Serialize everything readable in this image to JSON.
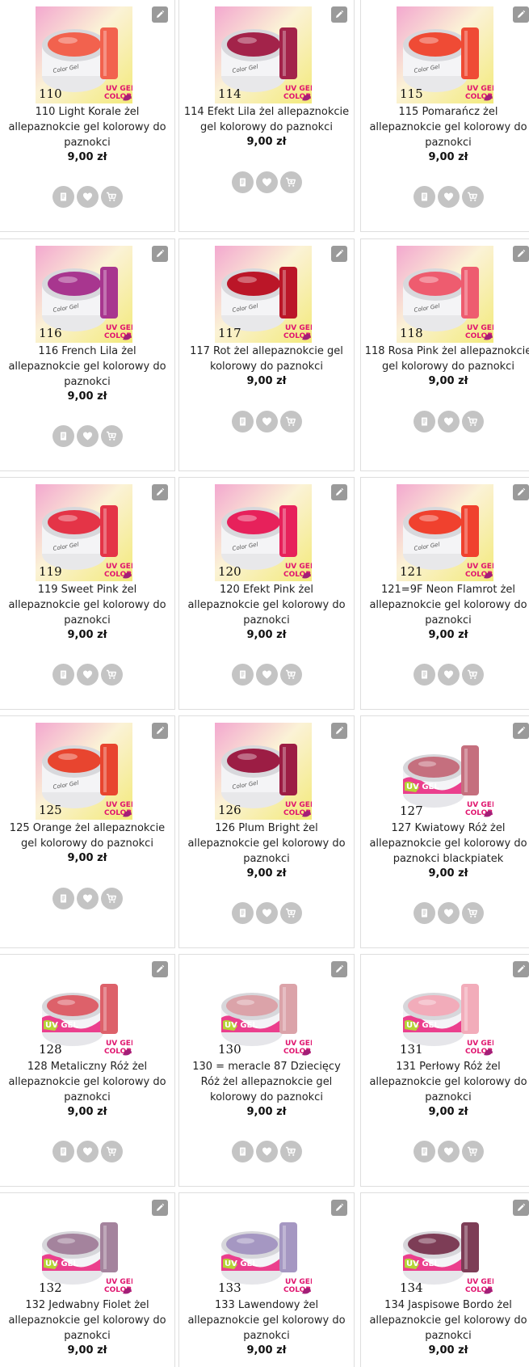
{
  "currency": "zł",
  "icons": {
    "edit": "pencil-icon",
    "details": "document-icon",
    "wishlist": "heart-icon",
    "cart": "cart-icon"
  },
  "products": [
    {
      "num": "110",
      "name": "110 Light Korale żel allepaznokcie gel kolorowy do paznokci",
      "price": "9,00 zł",
      "style": "a",
      "color": "#f2624e"
    },
    {
      "num": "114",
      "name": "114 Efekt Lila żel allepaznokcie gel kolorowy do paznokci",
      "price": "9,00 zł",
      "style": "a",
      "color": "#a3234a"
    },
    {
      "num": "115",
      "name": "115 Pomarańcz żel allepaznokcie gel kolorowy do paznokci",
      "price": "9,00 zł",
      "style": "a",
      "color": "#ef4b35"
    },
    {
      "num": "116",
      "name": "116 French Lila żel allepaznokcie gel kolorowy do paznokci",
      "price": "9,00 zł",
      "style": "a",
      "color": "#a8368f"
    },
    {
      "num": "117",
      "name": "117 Rot żel allepaznokcie gel kolorowy do paznokci",
      "price": "9,00 zł",
      "style": "a",
      "color": "#bb1628"
    },
    {
      "num": "118",
      "name": "118 Rosa Pink żel allepaznokcie gel kolorowy do paznokci",
      "price": "9,00 zł",
      "style": "a",
      "color": "#ee5c6f"
    },
    {
      "num": "119",
      "name": "119 Sweet Pink żel allepaznokcie gel kolorowy do paznokci",
      "price": "9,00 zł",
      "style": "a",
      "color": "#e43447"
    },
    {
      "num": "120",
      "name": "120 Efekt Pink żel allepaznokcie gel kolorowy do paznokci",
      "price": "9,00 zł",
      "style": "a",
      "color": "#e7215b"
    },
    {
      "num": "121",
      "name": "121=9F Neon Flamrot żel allepaznokcie gel kolorowy do paznokci",
      "price": "9,00 zł",
      "style": "a",
      "color": "#f0412e"
    },
    {
      "num": "125",
      "name": "125 Orange żel allepaznokcie gel kolorowy do paznokci",
      "price": "9,00 zł",
      "style": "a",
      "color": "#e8452f"
    },
    {
      "num": "126",
      "name": "126 Plum Bright żel allepaznokcie gel kolorowy do paznokci",
      "price": "9,00 zł",
      "style": "a",
      "color": "#9c1d44"
    },
    {
      "num": "127",
      "name": "127 Kwiatowy Róż żel allepaznokcie gel kolorowy do paznokci blackpiatek",
      "price": "9,00 zł",
      "style": "b",
      "color": "#c56f7e"
    },
    {
      "num": "128",
      "name": "128 Metaliczny Róż żel allepaznokcie gel kolorowy do paznokci",
      "price": "9,00 zł",
      "style": "b",
      "color": "#dd616a"
    },
    {
      "num": "130",
      "name": "130 = meracle 87 Dziecięcy Róż żel allepaznokcie gel kolorowy do paznokci",
      "price": "9,00 zł",
      "style": "b",
      "color": "#dba3a9"
    },
    {
      "num": "131",
      "name": "131 Perłowy Róż żel allepaznokcie gel kolorowy do paznokci",
      "price": "9,00 zł",
      "style": "b",
      "color": "#f2acba"
    },
    {
      "num": "132",
      "name": "132 Jedwabny Fiolet żel allepaznokcie gel kolorowy do paznokci",
      "price": "9,00 zł",
      "style": "b",
      "color": "#a4839d"
    },
    {
      "num": "133",
      "name": "133 Lawendowy żel allepaznokcie gel kolorowy do paznokci",
      "price": "9,00 zł",
      "style": "b",
      "color": "#a597c2"
    },
    {
      "num": "134",
      "name": "134 Jaspisowe Bordo żel allepaznokcie gel kolorowy do paznokci",
      "price": "9,00 zł",
      "style": "b",
      "color": "#7d3d56"
    }
  ]
}
